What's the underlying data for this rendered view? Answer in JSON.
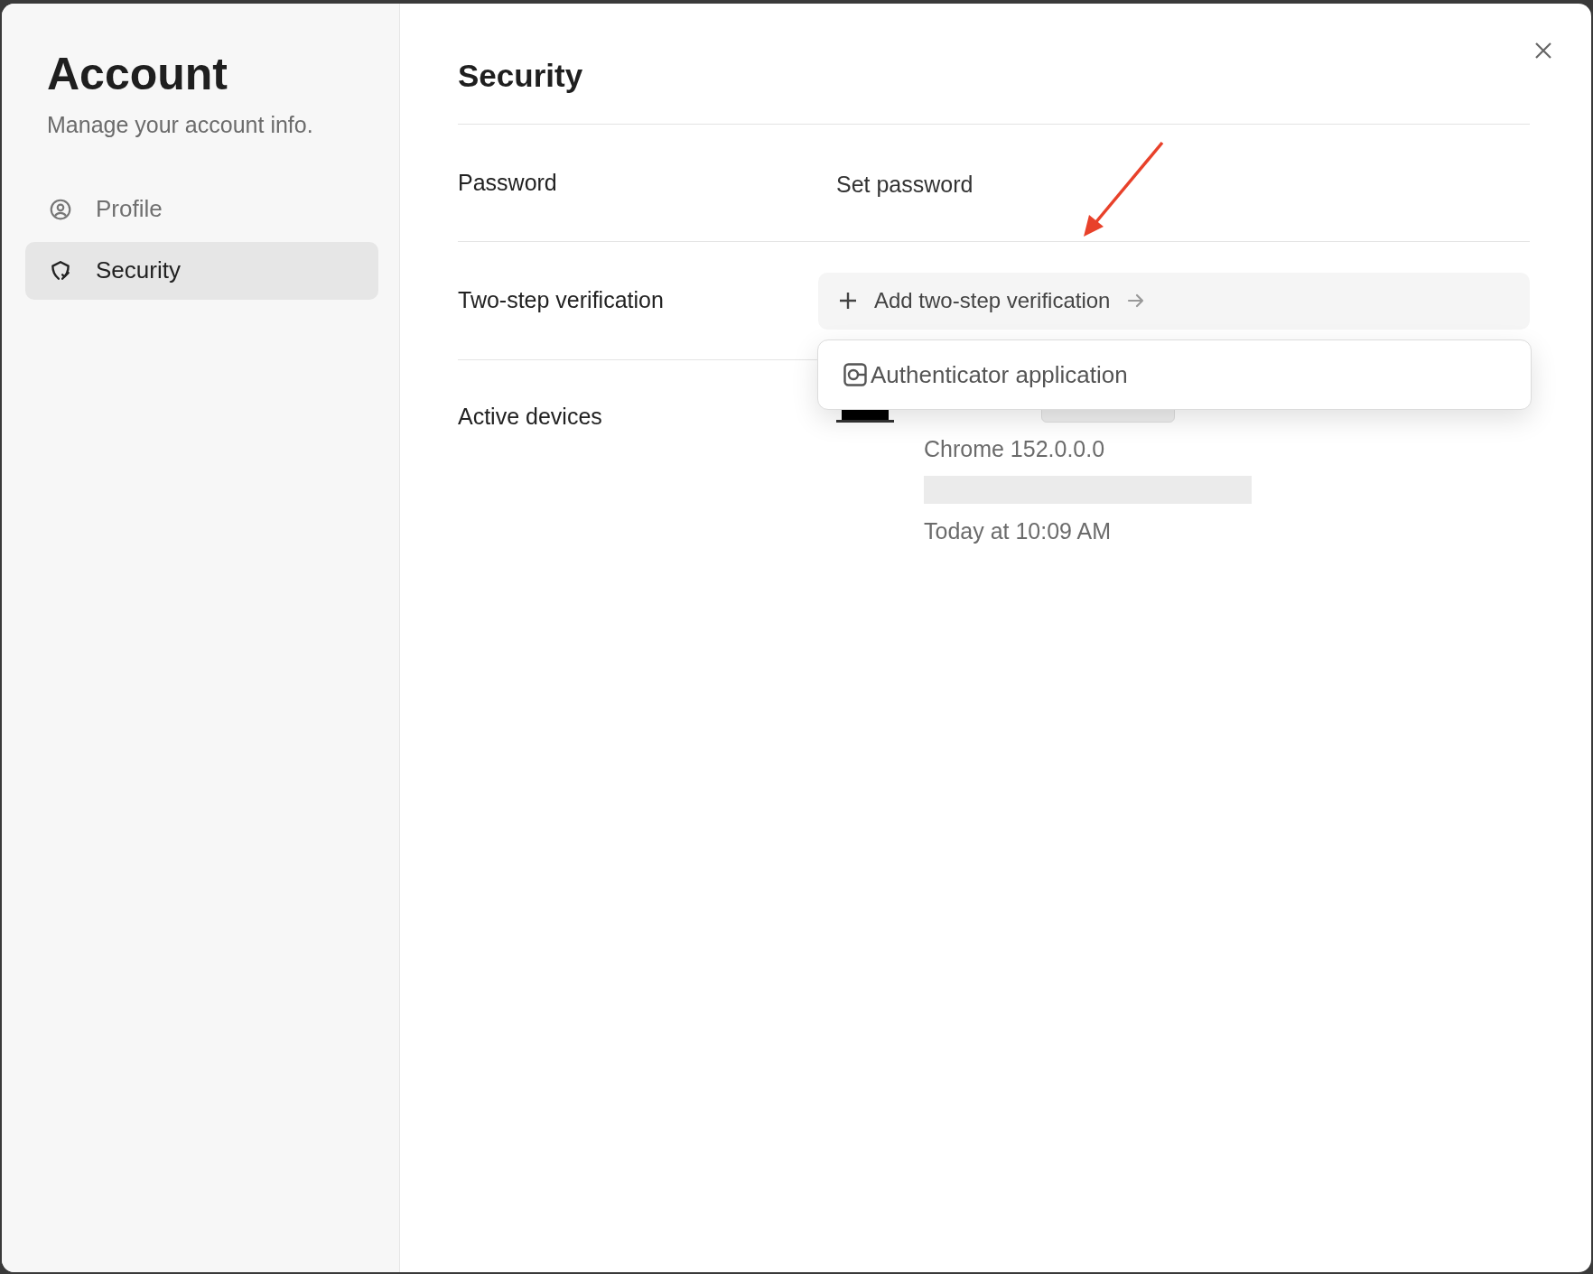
{
  "sidebar": {
    "title": "Account",
    "subtitle": "Manage your account info.",
    "items": [
      {
        "label": "Profile",
        "selected": false
      },
      {
        "label": "Security",
        "selected": true
      }
    ]
  },
  "main": {
    "title": "Security",
    "password": {
      "label": "Password",
      "value": "Set password"
    },
    "two_step": {
      "label": "Two-step verification",
      "button": "Add two-step verification"
    },
    "menu": {
      "items": [
        "Authenticator application"
      ]
    },
    "devices": {
      "label": "Active devices",
      "device": {
        "browser": "Chrome 152.0.0.0",
        "last_active": "Today at 10:09 AM"
      }
    }
  }
}
